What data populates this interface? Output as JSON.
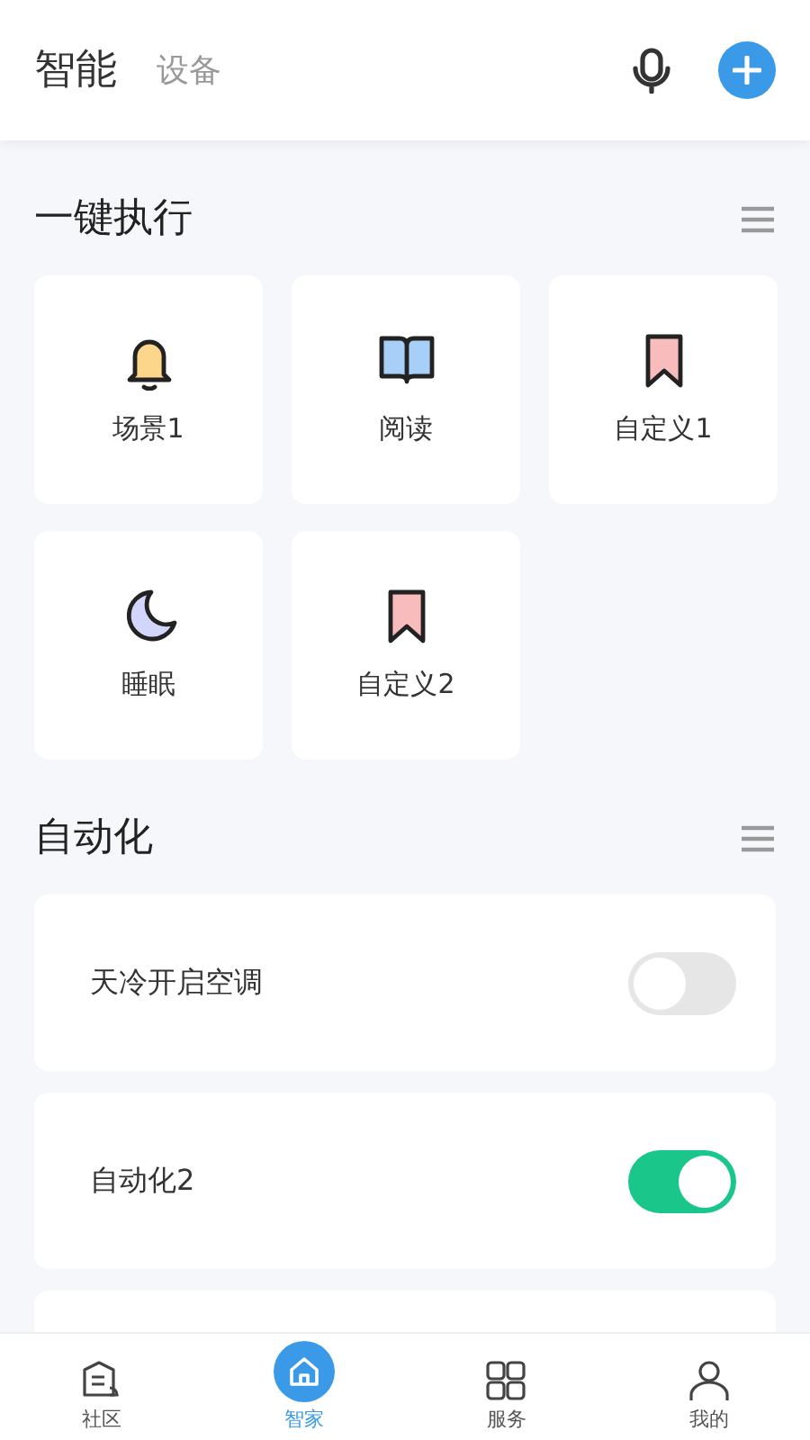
{
  "header": {
    "tabs": [
      {
        "label": "智能",
        "selected": true
      },
      {
        "label": "设备",
        "selected": false
      }
    ]
  },
  "quick_actions": {
    "title": "一键执行",
    "items": [
      {
        "label": "场景1",
        "kind": "bell"
      },
      {
        "label": "阅读",
        "kind": "book"
      },
      {
        "label": "自定义1",
        "kind": "bookmark"
      },
      {
        "label": "睡眠",
        "kind": "moon"
      },
      {
        "label": "自定义2",
        "kind": "bookmark"
      }
    ]
  },
  "automation": {
    "title": "自动化",
    "items": [
      {
        "label": "天冷开启空调",
        "on": false
      },
      {
        "label": "自动化2",
        "on": true
      }
    ]
  },
  "bottom_nav": [
    {
      "label": "社区",
      "kind": "community",
      "selected": false
    },
    {
      "label": "智家",
      "kind": "home",
      "selected": true
    },
    {
      "label": "服务",
      "kind": "services",
      "selected": false
    },
    {
      "label": "我的",
      "kind": "profile",
      "selected": false
    }
  ]
}
